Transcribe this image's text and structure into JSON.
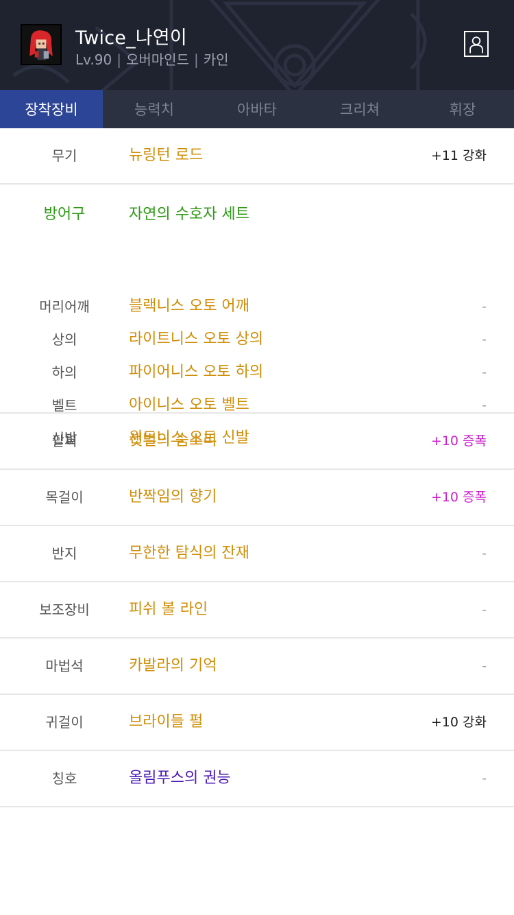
{
  "header": {
    "character_name": "Twice_나연이",
    "level": "Lv.90",
    "job": "오버마인드",
    "world": "카인",
    "separator": "|",
    "avatar_icon": "character-portrait-icon",
    "profile_icon": "person-profile-icon",
    "background_color": "#1f2330"
  },
  "tabs": [
    {
      "label": "장착장비",
      "active": true
    },
    {
      "label": "능력치",
      "active": false
    },
    {
      "label": "아바타",
      "active": false
    },
    {
      "label": "크리쳐",
      "active": false
    },
    {
      "label": "휘장",
      "active": false
    }
  ],
  "colors": {
    "active_tab": "#2d4596",
    "item_name": "#d08d06",
    "set_name": "#2f9a16",
    "amplify": "#cc1fcf",
    "title_item": "#4a19b5"
  },
  "weapon": {
    "slot": "무기",
    "item": "뉴링턴 로드",
    "enhancement": "+11 강화"
  },
  "armor": {
    "slot": "방어구",
    "set_name": "자연의 수호자 세트",
    "pieces": [
      {
        "slot": "머리어깨",
        "item": "블랙니스 오토 어깨",
        "enhancement": "-"
      },
      {
        "slot": "상의",
        "item": "라이트니스 오토 상의",
        "enhancement": "-"
      },
      {
        "slot": "하의",
        "item": "파이어니스 오토 하의",
        "enhancement": "-"
      },
      {
        "slot": "벨트",
        "item": "아이니스 오토 벨트",
        "enhancement": "-"
      },
      {
        "slot": "신발",
        "item": "윈드니스 오토 신발",
        "enhancement": "-"
      }
    ]
  },
  "accessories": [
    {
      "slot": "팔찌",
      "item": "샛별의 숨소리",
      "enhancement": "+10 증폭"
    },
    {
      "slot": "목걸이",
      "item": "반짝임의 향기",
      "enhancement": "+10 증폭"
    },
    {
      "slot": "반지",
      "item": "무한한 탐식의 잔재",
      "enhancement": "-"
    },
    {
      "slot": "보조장비",
      "item": "피쉬 볼 라인",
      "enhancement": "-"
    },
    {
      "slot": "마법석",
      "item": "카발라의 기억",
      "enhancement": "-"
    },
    {
      "slot": "귀걸이",
      "item": "브라이들 펄",
      "enhancement": "+10 강화"
    },
    {
      "slot": "칭호",
      "item": "올림푸스의 권능",
      "enhancement": "-"
    }
  ]
}
